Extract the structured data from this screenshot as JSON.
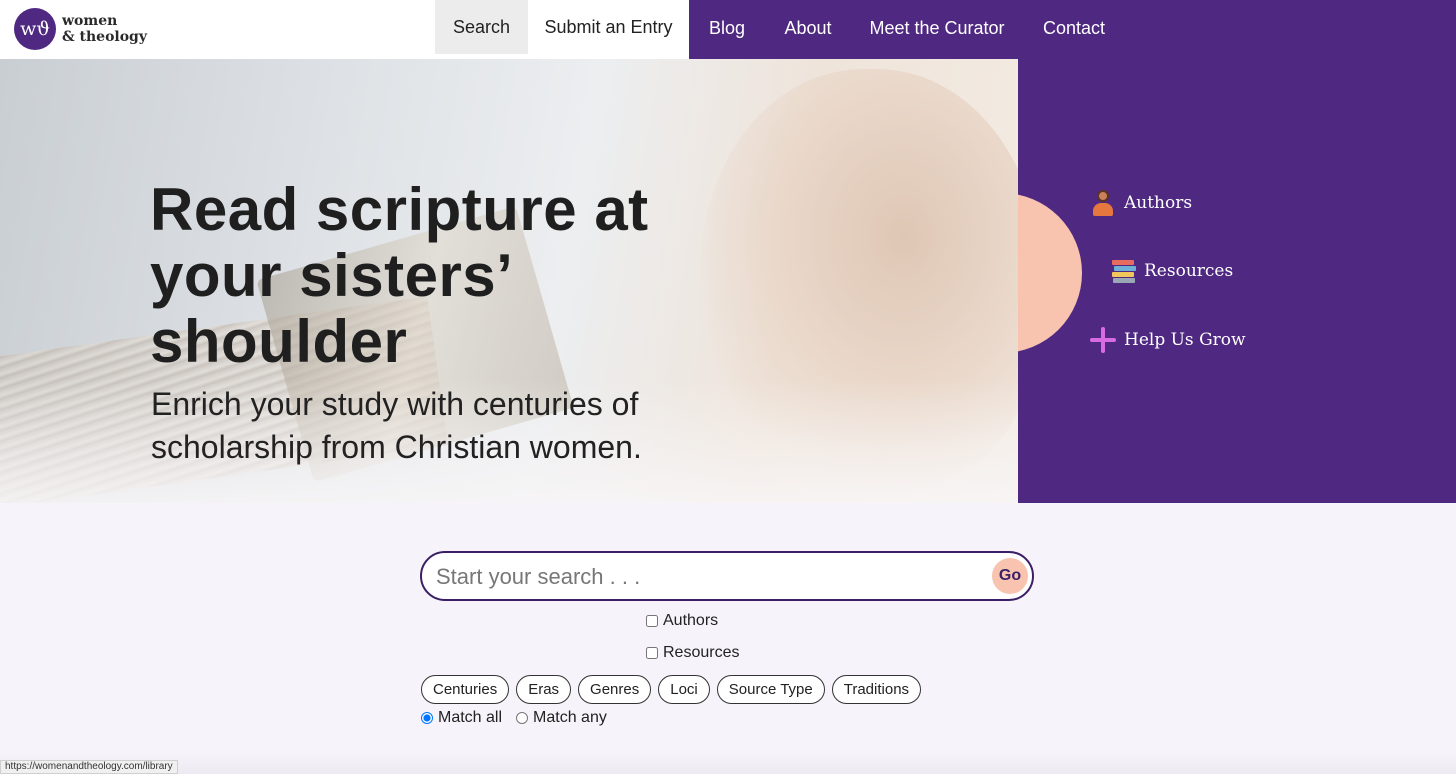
{
  "logo": {
    "mark": "wϑ",
    "line1": "women",
    "line2": "& theology"
  },
  "nav": {
    "search": "Search",
    "submit": "Submit an Entry",
    "blog": "Blog",
    "about": "About",
    "curator": "Meet the Curator",
    "contact": "Contact"
  },
  "hero": {
    "title": "Read scripture at your sisters’ shoulder",
    "subtitle": "Enrich your study with centuries of scholarship from Christian women."
  },
  "panel": {
    "authors": {
      "label": "Authors",
      "icon": "author-icon"
    },
    "resources": {
      "label": "Resources",
      "icon": "books-icon"
    },
    "grow": {
      "label": "Help Us Grow",
      "icon": "plus-icon"
    }
  },
  "search": {
    "placeholder": "Start your search . . .",
    "go": "Go",
    "checkboxes": {
      "authors": "Authors",
      "resources": "Resources"
    },
    "filters": [
      "Centuries",
      "Eras",
      "Genres",
      "Loci",
      "Source Type",
      "Traditions"
    ],
    "match_all": "Match all",
    "match_any": "Match any",
    "match_selected": "all"
  },
  "status": {
    "url": "https://womenandtheology.com/library"
  },
  "colors": {
    "brand_purple": "#4f2882",
    "peach": "#f8c3af",
    "background": "#f7f3fb"
  }
}
